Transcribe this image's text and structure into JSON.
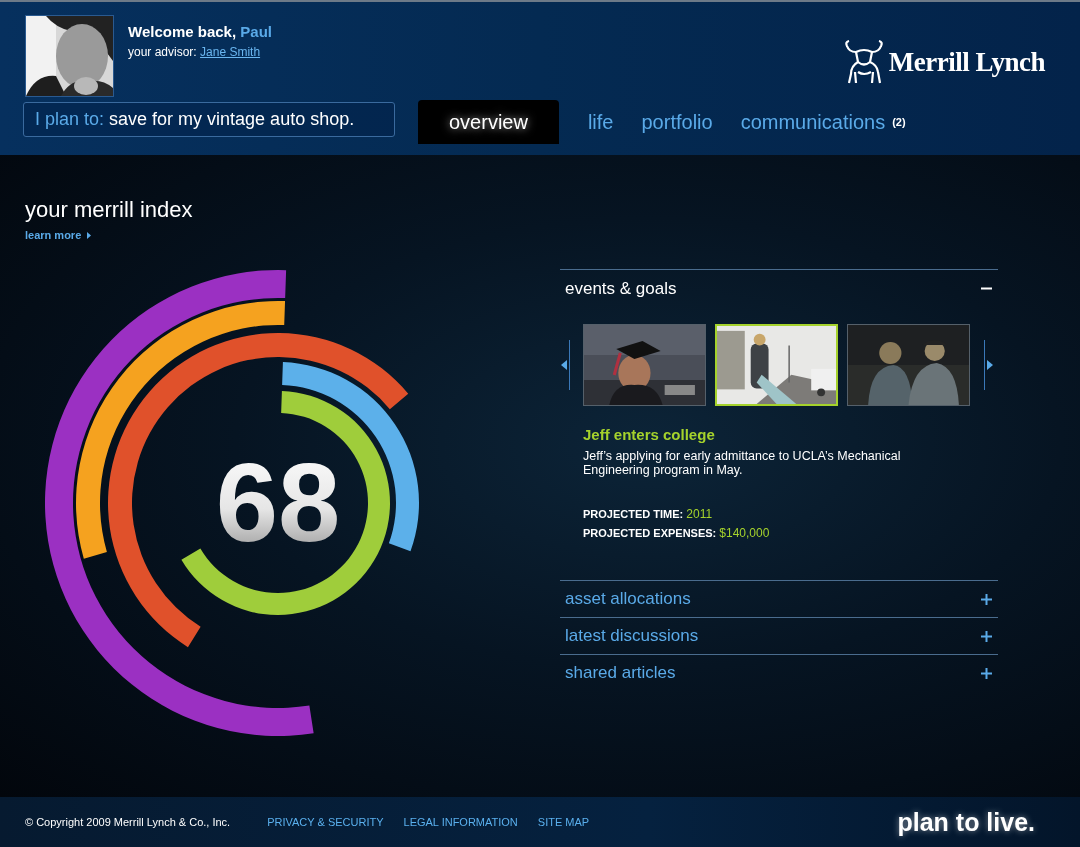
{
  "user": {
    "greeting": "Welcome back,",
    "name": "Paul",
    "advisor_label": "your advisor:",
    "advisor": "Jane Smith"
  },
  "brand": {
    "name": "Merrill Lynch"
  },
  "plan": {
    "label": "I plan to:",
    "value": "save for my vintage auto shop."
  },
  "tabs": [
    {
      "label": "overview",
      "selected": true
    },
    {
      "label": "life",
      "selected": false
    },
    {
      "label": "portfolio",
      "selected": false
    },
    {
      "label": "communications",
      "selected": false,
      "badge": "(2)"
    }
  ],
  "index": {
    "title": "your merrill index",
    "link": "learn more",
    "score": "68"
  },
  "sections": [
    {
      "title": "events & goals",
      "expanded": true,
      "thumbnails": [
        {
          "kind": "picture",
          "selected": false
        },
        {
          "kind": "picture",
          "selected": true
        },
        {
          "kind": "picture",
          "selected": false
        }
      ],
      "event": {
        "title": "Jeff enters college",
        "description": "Jeff’s applying for early admittance to UCLA’s Mechanical Engineering program in May.",
        "facts": [
          {
            "label": "PROJECTED TIME:",
            "value": "2011"
          },
          {
            "label": "PROJECTED EXPENSES:",
            "value": "$140,000"
          }
        ]
      }
    },
    {
      "title": "asset allocations",
      "expanded": false
    },
    {
      "title": "latest discussions",
      "expanded": false
    },
    {
      "title": "shared articles",
      "expanded": false
    }
  ],
  "footer": {
    "copyright": "© Copyright 2009 Merrill Lynch & Co., Inc.",
    "links": [
      "PRIVACY & SECURITY",
      "LEGAL INFORMATION",
      "SITE MAP"
    ],
    "tagline": "plan to live."
  }
}
